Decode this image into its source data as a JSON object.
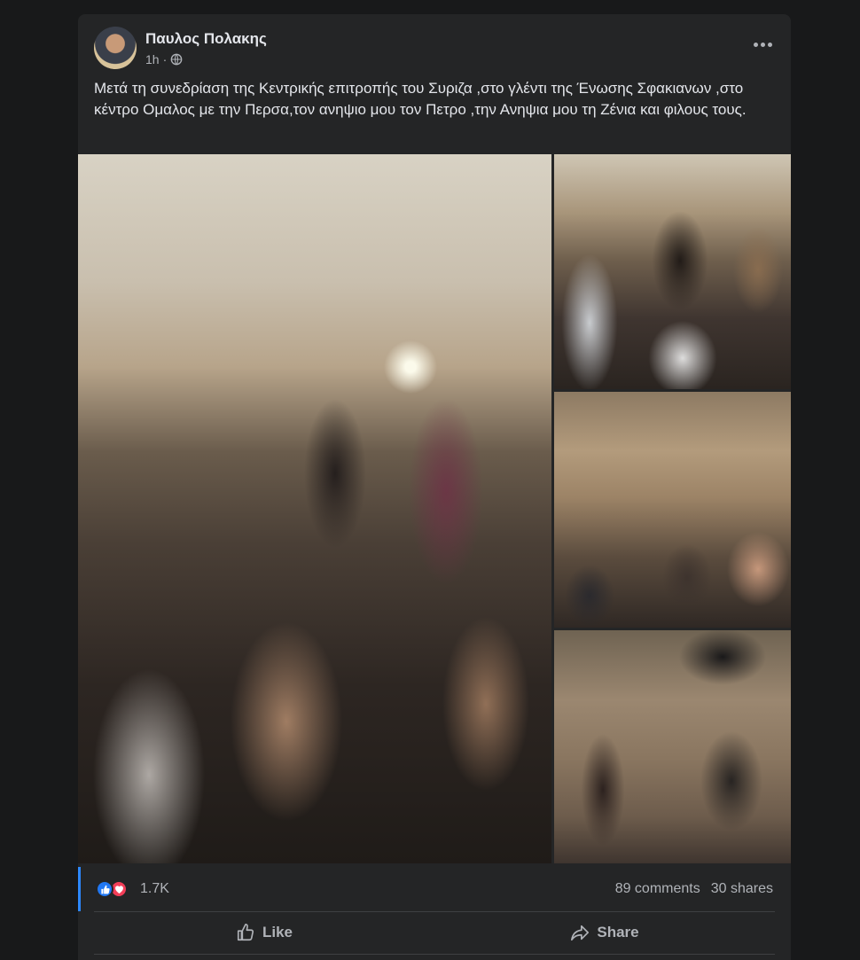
{
  "post": {
    "author": "Παυλος Πολακης",
    "time": "1h",
    "text": "Μετά τη συνεδρίαση της Κεντρικής επιτροπής του Συριζα ,στο γλέντι της Ένωσης  Σφακιανων ,στο κέντρο Ομαλος με την Περσα,τον ανηψιο μου τον Πετρο ,την Ανηψια μου τη Ζένια και φιλους τους.",
    "photos_count": 4
  },
  "reactions": {
    "count": "1.7K",
    "types": [
      "like-icon",
      "love-icon"
    ]
  },
  "stats": {
    "comments": "89 comments",
    "shares": "30 shares"
  },
  "actions": {
    "like": "Like",
    "share": "Share"
  },
  "colors": {
    "background": "#18191a",
    "card": "#242526",
    "text": "#e4e6eb",
    "secondary": "#b0b3b8",
    "like_blue": "#2078f4",
    "love_red": "#f33e58"
  }
}
